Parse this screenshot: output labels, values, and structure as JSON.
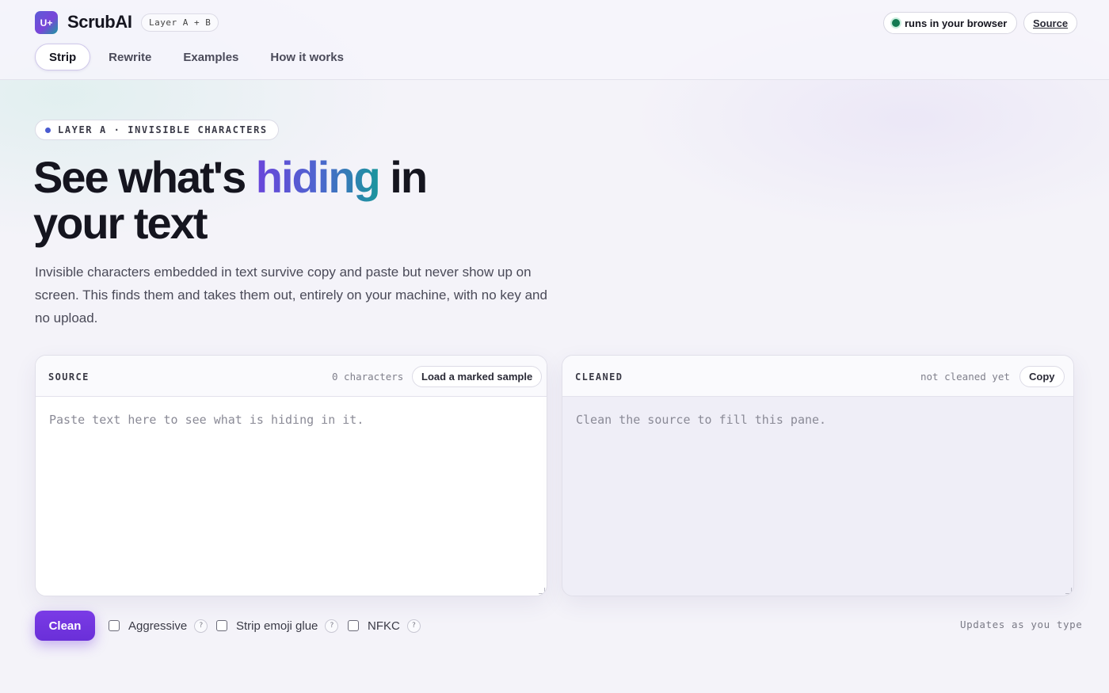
{
  "header": {
    "logo_mark": "U+",
    "brand": "ScrubAI",
    "layer_badge": "Layer A + B",
    "status": "runs in your browser",
    "source_link": "Source",
    "colors": {
      "accent": "#6a2fd8",
      "status_dot": "#137a52"
    }
  },
  "nav": {
    "items": [
      {
        "label": "Strip",
        "active": true
      },
      {
        "label": "Rewrite",
        "active": false
      },
      {
        "label": "Examples",
        "active": false
      },
      {
        "label": "How it works",
        "active": false
      }
    ]
  },
  "hero": {
    "eyebrow": "LAYER A · INVISIBLE CHARACTERS",
    "headline_before": "See what's ",
    "headline_accent": "hiding",
    "headline_after": " in your text",
    "lede": "Invisible characters embedded in text survive copy and paste but never show up on screen. This finds them and takes them out, entirely on your machine, with no key and no upload."
  },
  "source_panel": {
    "title": "SOURCE",
    "count": "0 characters",
    "sample_button": "Load a marked sample",
    "value": "",
    "placeholder": "Paste text here to see what is hiding in it."
  },
  "cleaned_panel": {
    "title": "CLEANED",
    "status": "not cleaned yet",
    "copy_button": "Copy",
    "value": "",
    "placeholder": "Clean the source to fill this pane."
  },
  "controls": {
    "clean_button": "Clean",
    "options": [
      {
        "label": "Aggressive",
        "checked": false,
        "help": "?"
      },
      {
        "label": "Strip emoji glue",
        "checked": false,
        "help": "?"
      },
      {
        "label": "NFKC",
        "checked": false,
        "help": "?"
      }
    ],
    "updates_note": "Updates as you type"
  }
}
